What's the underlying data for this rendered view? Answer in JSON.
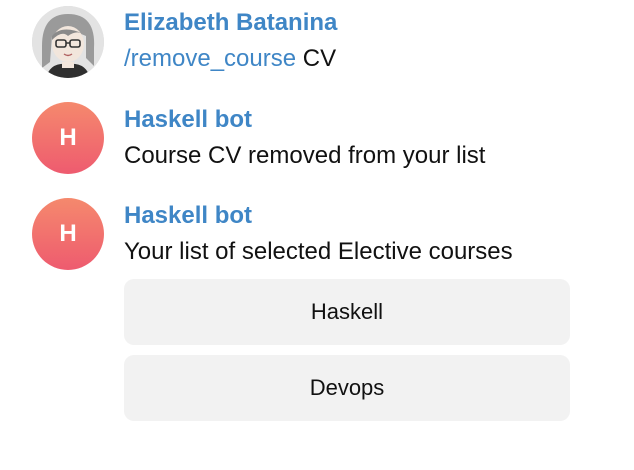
{
  "messages": [
    {
      "sender": "Elizabeth Batanina",
      "command": "/remove_course",
      "argument": " CV",
      "avatar_icon": "user-portrait-avatar"
    },
    {
      "sender": "Haskell bot",
      "avatar_letter": "H",
      "text": "Course CV removed from your list"
    },
    {
      "sender": "Haskell bot",
      "avatar_letter": "H",
      "text": "Your list of selected Elective courses",
      "keyboard": [
        "Haskell",
        "Devops"
      ]
    }
  ],
  "colors": {
    "sender_name": "#3f86c6",
    "command_link": "#3f86c6",
    "bot_avatar_gradient": [
      "#f5896d",
      "#ee5b6f"
    ],
    "keyboard_button_bg": "#f2f2f2"
  }
}
